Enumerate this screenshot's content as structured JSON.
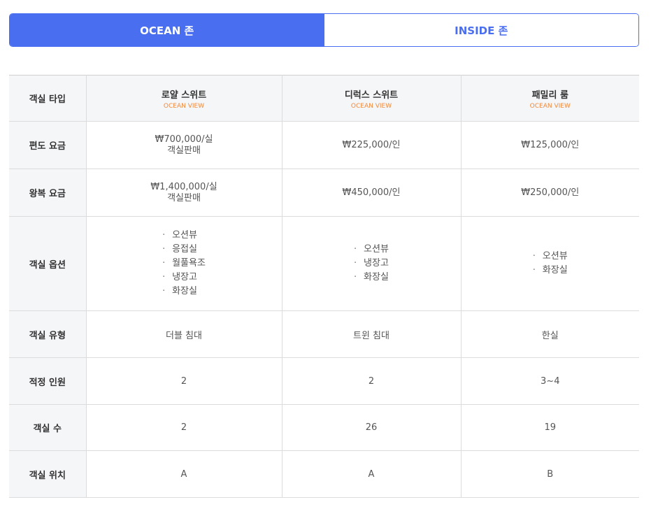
{
  "tabs": [
    {
      "label": "OCEAN 존",
      "active": true
    },
    {
      "label": "INSIDE 존",
      "active": false
    }
  ],
  "table": {
    "corner": "객실 타입",
    "columns": [
      {
        "name": "로얄 스위트",
        "sub": "OCEAN VIEW"
      },
      {
        "name": "디럭스 스위트",
        "sub": "OCEAN VIEW"
      },
      {
        "name": "패밀리 룸",
        "sub": "OCEAN VIEW"
      }
    ],
    "rows": {
      "oneway": {
        "label": "편도 요금",
        "cells": [
          [
            "₩700,000/실",
            "객실판매"
          ],
          [
            "₩225,000/인"
          ],
          [
            "₩125,000/인"
          ]
        ]
      },
      "round": {
        "label": "왕복 요금",
        "cells": [
          [
            "₩1,400,000/실",
            "객실판매"
          ],
          [
            "₩450,000/인"
          ],
          [
            "₩250,000/인"
          ]
        ]
      },
      "options": {
        "label": "객실 옵션",
        "bullet": "·",
        "cells": [
          [
            "오션뷰",
            "응접실",
            "월풀욕조",
            "냉장고",
            "화장실"
          ],
          [
            "오션뷰",
            "냉장고",
            "화장실"
          ],
          [
            "오션뷰",
            "화장실"
          ]
        ]
      },
      "bedtype": {
        "label": "객실 유형",
        "cells": [
          "더블 침대",
          "트윈 침대",
          "한실"
        ]
      },
      "capacity": {
        "label": "적정 인원",
        "cells": [
          "2",
          "2",
          "3~4"
        ]
      },
      "count": {
        "label": "객실 수",
        "cells": [
          "2",
          "26",
          "19"
        ]
      },
      "location": {
        "label": "객실 위치",
        "cells": [
          "A",
          "A",
          "B"
        ]
      }
    }
  }
}
